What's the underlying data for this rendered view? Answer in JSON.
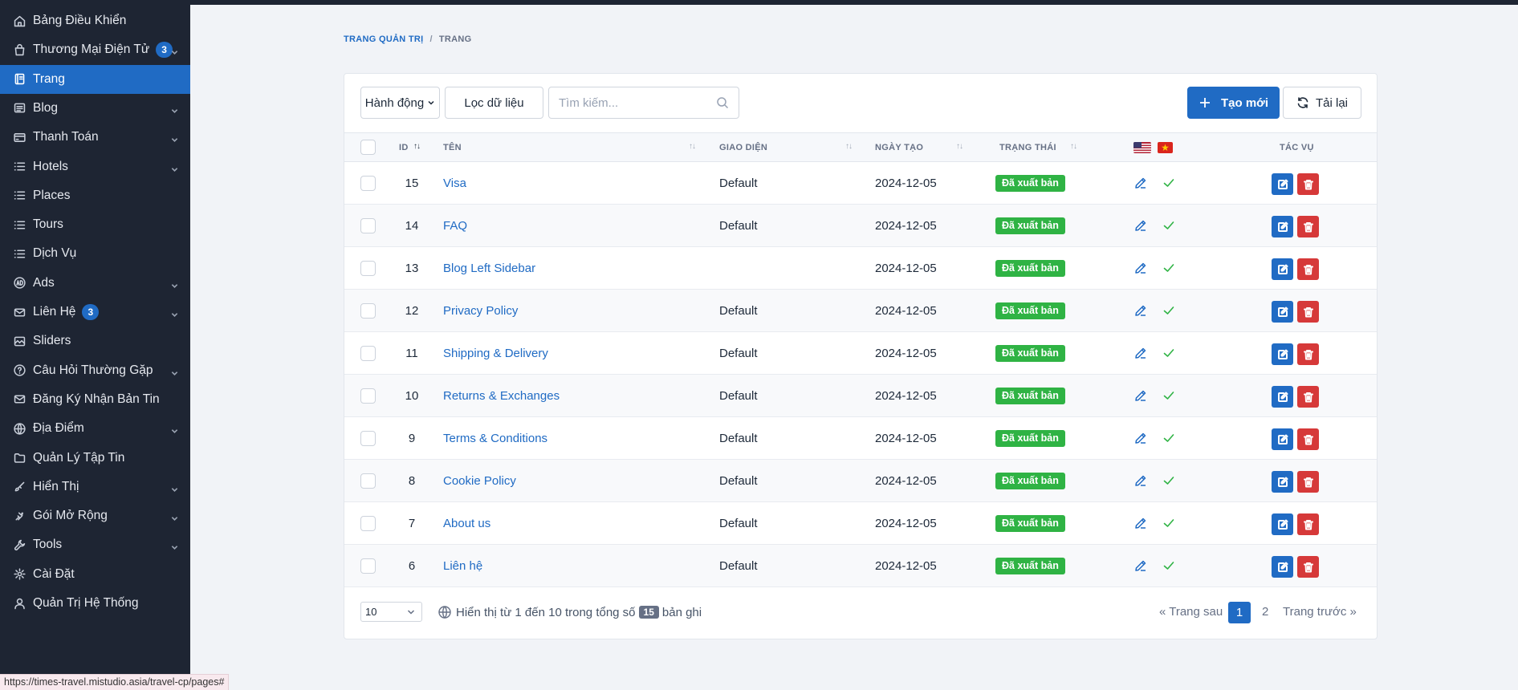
{
  "sidebar": {
    "items": [
      {
        "label": "Bảng Điều Khiển",
        "icon": "home-icon",
        "badge": null,
        "chevron": false,
        "active": false
      },
      {
        "label": "Thương Mại Điện Tử",
        "icon": "shopping-bag-icon",
        "badge": "3",
        "chevron": true,
        "active": false
      },
      {
        "label": "Trang",
        "icon": "page-icon",
        "badge": null,
        "chevron": false,
        "active": true
      },
      {
        "label": "Blog",
        "icon": "article-icon",
        "badge": null,
        "chevron": true,
        "active": false
      },
      {
        "label": "Thanh Toán",
        "icon": "credit-card-icon",
        "badge": null,
        "chevron": true,
        "active": false
      },
      {
        "label": "Hotels",
        "icon": "list-icon",
        "badge": null,
        "chevron": true,
        "active": false
      },
      {
        "label": "Places",
        "icon": "list-icon",
        "badge": null,
        "chevron": false,
        "active": false
      },
      {
        "label": "Tours",
        "icon": "list-icon",
        "badge": null,
        "chevron": false,
        "active": false
      },
      {
        "label": "Dịch Vụ",
        "icon": "list-icon",
        "badge": null,
        "chevron": false,
        "active": false
      },
      {
        "label": "Ads",
        "icon": "ad-icon",
        "badge": null,
        "chevron": true,
        "active": false
      },
      {
        "label": "Liên Hệ",
        "icon": "mail-icon",
        "badge": "3",
        "chevron": true,
        "active": false
      },
      {
        "label": "Sliders",
        "icon": "slideshow-icon",
        "badge": null,
        "chevron": false,
        "active": false
      },
      {
        "label": "Câu Hỏi Thường Gặp",
        "icon": "help-circle-icon",
        "badge": null,
        "chevron": true,
        "active": false
      },
      {
        "label": "Đăng Ký Nhận Bản Tin",
        "icon": "mail-icon",
        "badge": null,
        "chevron": false,
        "active": false
      },
      {
        "label": "Địa Điểm",
        "icon": "globe-icon",
        "badge": null,
        "chevron": true,
        "active": false
      },
      {
        "label": "Quản Lý Tập Tin",
        "icon": "folder-icon",
        "badge": null,
        "chevron": false,
        "active": false
      },
      {
        "label": "Hiển Thị",
        "icon": "brush-icon",
        "badge": null,
        "chevron": true,
        "active": false
      },
      {
        "label": "Gói Mở Rộng",
        "icon": "plug-icon",
        "badge": null,
        "chevron": true,
        "active": false
      },
      {
        "label": "Tools",
        "icon": "tool-icon",
        "badge": null,
        "chevron": true,
        "active": false
      },
      {
        "label": "Cài Đặt",
        "icon": "gear-icon",
        "badge": null,
        "chevron": false,
        "active": false
      },
      {
        "label": "Quản Trị Hệ Thống",
        "icon": "user-icon",
        "badge": null,
        "chevron": false,
        "active": false
      }
    ]
  },
  "breadcrumb": {
    "root": "TRANG QUẢN TRỊ",
    "separator": "/",
    "current": "TRANG"
  },
  "toolbar": {
    "actions_label": "Hành động",
    "filter_label": "Lọc dữ liệu",
    "search_placeholder": "Tìm kiếm...",
    "create_label": "Tạo mới",
    "reload_label": "Tải lại"
  },
  "table": {
    "headers": {
      "id": "ID",
      "name": "TÊN",
      "template": "GIAO DIỆN",
      "created": "NGÀY TẠO",
      "status": "TRẠNG THÁI",
      "actions": "TÁC VỤ"
    },
    "rows": [
      {
        "id": "15",
        "name": "Visa",
        "template": "Default",
        "created": "2024-12-05",
        "status": "Đã xuất bản"
      },
      {
        "id": "14",
        "name": "FAQ",
        "template": "Default",
        "created": "2024-12-05",
        "status": "Đã xuất bản"
      },
      {
        "id": "13",
        "name": "Blog Left Sidebar",
        "template": "",
        "created": "2024-12-05",
        "status": "Đã xuất bản"
      },
      {
        "id": "12",
        "name": "Privacy Policy",
        "template": "Default",
        "created": "2024-12-05",
        "status": "Đã xuất bản"
      },
      {
        "id": "11",
        "name": "Shipping & Delivery",
        "template": "Default",
        "created": "2024-12-05",
        "status": "Đã xuất bản"
      },
      {
        "id": "10",
        "name": "Returns & Exchanges",
        "template": "Default",
        "created": "2024-12-05",
        "status": "Đã xuất bản"
      },
      {
        "id": "9",
        "name": "Terms & Conditions",
        "template": "Default",
        "created": "2024-12-05",
        "status": "Đã xuất bản"
      },
      {
        "id": "8",
        "name": "Cookie Policy",
        "template": "Default",
        "created": "2024-12-05",
        "status": "Đã xuất bản"
      },
      {
        "id": "7",
        "name": "About us",
        "template": "Default",
        "created": "2024-12-05",
        "status": "Đã xuất bản"
      },
      {
        "id": "6",
        "name": "Liên hệ",
        "template": "Default",
        "created": "2024-12-05",
        "status": "Đã xuất bản"
      }
    ]
  },
  "pagination": {
    "per_page": "10",
    "info_prefix": "Hiển thị từ 1 đến 10 trong tổng số",
    "total": "15",
    "info_suffix": "bản ghi",
    "prev_label": "« Trang sau",
    "pages": [
      "1",
      "2"
    ],
    "current_page": "1",
    "next_label": "Trang trước »"
  },
  "status_url": "https://times-travel.mistudio.asia/travel-cp/pages#",
  "colors": {
    "primary": "#206bc4",
    "success": "#2fb344",
    "danger": "#d63939",
    "sidebar_bg": "#1e2533"
  }
}
